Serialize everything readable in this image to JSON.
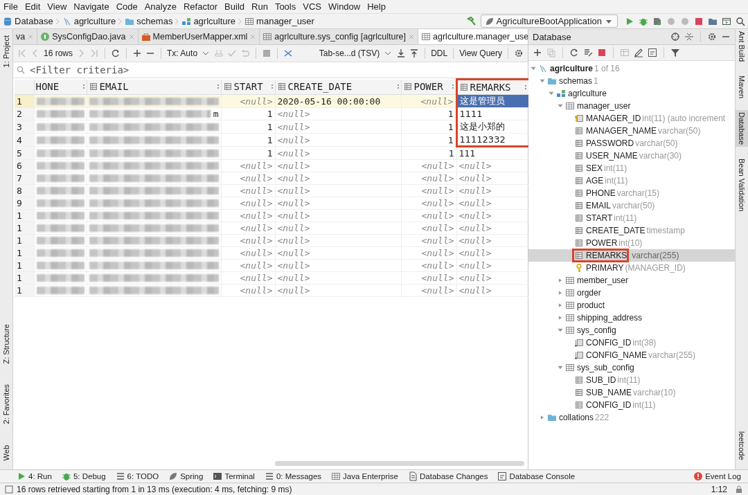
{
  "menu": [
    {
      "label": "File"
    },
    {
      "label": "Edit"
    },
    {
      "label": "View"
    },
    {
      "label": "Navigate"
    },
    {
      "label": "Code"
    },
    {
      "label": "Analyze"
    },
    {
      "label": "Refactor"
    },
    {
      "label": "Build"
    },
    {
      "label": "Run"
    },
    {
      "label": "Tools"
    },
    {
      "label": "VCS"
    },
    {
      "label": "Window"
    },
    {
      "label": "Help"
    }
  ],
  "breadcrumb": [
    {
      "label": "Database",
      "kind": "db"
    },
    {
      "label": "agrlculture",
      "kind": "conn"
    },
    {
      "label": "schemas",
      "kind": "folder"
    },
    {
      "label": "agrlculture",
      "kind": "schema"
    },
    {
      "label": "manager_user",
      "kind": "table"
    }
  ],
  "run_config": {
    "label": "AgricultureBootApplication"
  },
  "left_tool_windows": [
    {
      "label": "1: Project",
      "kind": "top"
    },
    {
      "label": "Z: Structure",
      "kind": "bottom"
    },
    {
      "label": "2: Favorites",
      "kind": "bottom"
    },
    {
      "label": "Web",
      "kind": "bottom"
    }
  ],
  "editor_tabs": [
    {
      "label": "va",
      "kind": "none",
      "selected": false
    },
    {
      "label": "SysConfigDao.java",
      "kind": "java",
      "selected": false
    },
    {
      "label": "MemberUserMapper.xml",
      "kind": "xml",
      "selected": false
    },
    {
      "label": "agrlculture.sys_config [agrlculture]",
      "kind": "table",
      "selected": false
    },
    {
      "label": "agrlculture.manager_use",
      "kind": "table",
      "selected": true
    }
  ],
  "data_toolbar": {
    "rows": "16 rows",
    "transaction": "Tx: Auto",
    "format": "Tab-se...d (TSV)",
    "ddl": "DDL",
    "view_query": "View Query"
  },
  "filter": {
    "placeholder": "<Filter criteria>"
  },
  "table": {
    "columns": [
      {
        "label": "HONE",
        "kind": "text",
        "highlighted": false
      },
      {
        "label": "EMAIL",
        "kind": "text",
        "highlighted": false
      },
      {
        "label": "START",
        "kind": "number",
        "highlighted": false
      },
      {
        "label": "CREATE_DATE",
        "kind": "text",
        "highlighted": false
      },
      {
        "label": "POWER",
        "kind": "number",
        "highlighted": false
      },
      {
        "label": "REMARKS",
        "kind": "text",
        "highlighted": true
      }
    ],
    "rows": [
      {
        "number": "1",
        "current": true,
        "highlighted": true,
        "cells": [
          {
            "kind": "redacted",
            "selected": false
          },
          {
            "kind": "redacted",
            "selected": false
          },
          {
            "kind": "null",
            "text": "<null>",
            "selected": false
          },
          {
            "kind": "value",
            "text": "2020-05-16 00:00:00",
            "selected": false
          },
          {
            "kind": "null",
            "text": "<null>",
            "selected": false
          },
          {
            "kind": "value",
            "text": "这是管理员",
            "selected": true
          }
        ]
      },
      {
        "number": "2",
        "current": false,
        "highlighted": true,
        "cells": [
          {
            "kind": "redacted",
            "selected": false
          },
          {
            "kind": "redacted",
            "text": "m",
            "selected": false
          },
          {
            "kind": "value",
            "text": "1",
            "selected": false
          },
          {
            "kind": "null",
            "text": "<null>",
            "selected": false
          },
          {
            "kind": "value",
            "text": "1",
            "selected": false
          },
          {
            "kind": "value",
            "text": "1111",
            "selected": false
          }
        ]
      },
      {
        "number": "3",
        "current": false,
        "highlighted": true,
        "cells": [
          {
            "kind": "redacted",
            "selected": false
          },
          {
            "kind": "redacted",
            "selected": false
          },
          {
            "kind": "value",
            "text": "1",
            "selected": false
          },
          {
            "kind": "null",
            "text": "<null>",
            "selected": false
          },
          {
            "kind": "value",
            "text": "1",
            "selected": false
          },
          {
            "kind": "value",
            "text": "这是小郑的",
            "selected": false
          }
        ]
      },
      {
        "number": "4",
        "current": false,
        "highlighted": true,
        "cells": [
          {
            "kind": "redacted",
            "selected": false
          },
          {
            "kind": "redacted",
            "selected": false
          },
          {
            "kind": "value",
            "text": "1",
            "selected": false
          },
          {
            "kind": "null",
            "text": "<null>",
            "selected": false
          },
          {
            "kind": "value",
            "text": "1",
            "selected": false
          },
          {
            "kind": "value",
            "text": "11112332",
            "selected": false
          }
        ]
      },
      {
        "number": "5",
        "current": false,
        "highlighted": false,
        "cells": [
          {
            "kind": "redacted",
            "selected": false
          },
          {
            "kind": "redacted",
            "selected": false
          },
          {
            "kind": "value",
            "text": "1",
            "selected": false
          },
          {
            "kind": "null",
            "text": "<null>",
            "selected": false
          },
          {
            "kind": "value",
            "text": "1",
            "selected": false
          },
          {
            "kind": "value",
            "text": "111",
            "selected": false
          }
        ]
      },
      {
        "number": "6",
        "current": false,
        "highlighted": false,
        "cells": [
          {
            "kind": "redacted",
            "selected": false
          },
          {
            "kind": "redacted",
            "selected": false
          },
          {
            "kind": "null",
            "text": "<null>",
            "selected": false
          },
          {
            "kind": "null",
            "text": "<null>",
            "selected": false
          },
          {
            "kind": "null",
            "text": "<null>",
            "selected": false
          },
          {
            "kind": "null",
            "text": "<null>",
            "selected": false
          }
        ]
      },
      {
        "number": "7",
        "current": false,
        "highlighted": false,
        "cells": [
          {
            "kind": "redacted",
            "selected": false
          },
          {
            "kind": "redacted",
            "selected": false
          },
          {
            "kind": "null",
            "text": "<null>",
            "selected": false
          },
          {
            "kind": "null",
            "text": "<null>",
            "selected": false
          },
          {
            "kind": "null",
            "text": "<null>",
            "selected": false
          },
          {
            "kind": "null",
            "text": "<null>",
            "selected": false
          }
        ]
      },
      {
        "number": "8",
        "current": false,
        "highlighted": false,
        "cells": [
          {
            "kind": "redacted",
            "selected": false
          },
          {
            "kind": "redacted",
            "selected": false
          },
          {
            "kind": "null",
            "text": "<null>",
            "selected": false
          },
          {
            "kind": "null",
            "text": "<null>",
            "selected": false
          },
          {
            "kind": "null",
            "text": "<null>",
            "selected": false
          },
          {
            "kind": "null",
            "text": "<null>",
            "selected": false
          }
        ]
      },
      {
        "number": "9",
        "current": false,
        "highlighted": false,
        "cells": [
          {
            "kind": "redacted",
            "selected": false
          },
          {
            "kind": "redacted",
            "selected": false
          },
          {
            "kind": "null",
            "text": "<null>",
            "selected": false
          },
          {
            "kind": "null",
            "text": "<null>",
            "selected": false
          },
          {
            "kind": "null",
            "text": "<null>",
            "selected": false
          },
          {
            "kind": "null",
            "text": "<null>",
            "selected": false
          }
        ]
      },
      {
        "number": "1",
        "current": false,
        "highlighted": false,
        "cells": [
          {
            "kind": "redacted",
            "selected": false
          },
          {
            "kind": "redacted",
            "selected": false
          },
          {
            "kind": "null",
            "text": "<null>",
            "selected": false
          },
          {
            "kind": "null",
            "text": "<null>",
            "selected": false
          },
          {
            "kind": "null",
            "text": "<null>",
            "selected": false
          },
          {
            "kind": "null",
            "text": "<null>",
            "selected": false
          }
        ]
      },
      {
        "number": "1",
        "current": false,
        "highlighted": false,
        "cells": [
          {
            "kind": "redacted",
            "selected": false
          },
          {
            "kind": "redacted",
            "selected": false
          },
          {
            "kind": "null",
            "text": "<null>",
            "selected": false
          },
          {
            "kind": "null",
            "text": "<null>",
            "selected": false
          },
          {
            "kind": "null",
            "text": "<null>",
            "selected": false
          },
          {
            "kind": "null",
            "text": "<null>",
            "selected": false
          }
        ]
      },
      {
        "number": "1",
        "current": false,
        "highlighted": false,
        "cells": [
          {
            "kind": "redacted",
            "selected": false
          },
          {
            "kind": "redacted",
            "selected": false
          },
          {
            "kind": "null",
            "text": "<null>",
            "selected": false
          },
          {
            "kind": "null",
            "text": "<null>",
            "selected": false
          },
          {
            "kind": "null",
            "text": "<null>",
            "selected": false
          },
          {
            "kind": "null",
            "text": "<null>",
            "selected": false
          }
        ]
      },
      {
        "number": "1",
        "current": false,
        "highlighted": false,
        "cells": [
          {
            "kind": "redacted",
            "selected": false
          },
          {
            "kind": "redacted",
            "selected": false
          },
          {
            "kind": "null",
            "text": "<null>",
            "selected": false
          },
          {
            "kind": "null",
            "text": "<null>",
            "selected": false
          },
          {
            "kind": "null",
            "text": "<null>",
            "selected": false
          },
          {
            "kind": "null",
            "text": "<null>",
            "selected": false
          }
        ]
      },
      {
        "number": "1",
        "current": false,
        "highlighted": false,
        "cells": [
          {
            "kind": "redacted",
            "selected": false
          },
          {
            "kind": "redacted",
            "selected": false
          },
          {
            "kind": "null",
            "text": "<null>",
            "selected": false
          },
          {
            "kind": "null",
            "text": "<null>",
            "selected": false
          },
          {
            "kind": "null",
            "text": "<null>",
            "selected": false
          },
          {
            "kind": "null",
            "text": "<null>",
            "selected": false
          }
        ]
      },
      {
        "number": "1",
        "current": false,
        "highlighted": false,
        "cells": [
          {
            "kind": "redacted",
            "selected": false
          },
          {
            "kind": "redacted",
            "selected": false
          },
          {
            "kind": "null",
            "text": "<null>",
            "selected": false
          },
          {
            "kind": "null",
            "text": "<null>",
            "selected": false
          },
          {
            "kind": "null",
            "text": "<null>",
            "selected": false
          },
          {
            "kind": "null",
            "text": "<null>",
            "selected": false
          }
        ]
      },
      {
        "number": "1",
        "current": false,
        "highlighted": false,
        "cells": [
          {
            "kind": "redacted",
            "selected": false
          },
          {
            "kind": "redacted",
            "selected": false
          },
          {
            "kind": "null",
            "text": "<null>",
            "selected": false
          },
          {
            "kind": "null",
            "text": "<null>",
            "selected": false
          },
          {
            "kind": "null",
            "text": "<null>",
            "selected": false
          },
          {
            "kind": "null",
            "text": "<null>",
            "selected": false
          }
        ]
      }
    ]
  },
  "database_panel": {
    "title": "Database",
    "tree": [
      {
        "label": "agrlculture",
        "kind": "conn",
        "count": "1 of 16",
        "expanded": true,
        "selected": false,
        "children": [
          {
            "label": "schemas",
            "kind": "folder",
            "count": "1",
            "expanded": true,
            "selected": false,
            "children": [
              {
                "label": "agrlculture",
                "kind": "schema",
                "expanded": true,
                "selected": false,
                "children": [
                  {
                    "label": "manager_user",
                    "kind": "table",
                    "expanded": true,
                    "selected": false,
                    "children": [
                      {
                        "label": "MANAGER_ID",
                        "detail": "int(11) (auto increment",
                        "kind": "pk-column",
                        "selected": false,
                        "highlighted": false
                      },
                      {
                        "label": "MANAGER_NAME",
                        "detail": "varchar(50)",
                        "kind": "column",
                        "selected": false,
                        "highlighted": false
                      },
                      {
                        "label": "PASSWORD",
                        "detail": "varchar(50)",
                        "kind": "column",
                        "selected": false,
                        "highlighted": false
                      },
                      {
                        "label": "USER_NAME",
                        "detail": "varchar(30)",
                        "kind": "column",
                        "selected": false,
                        "highlighted": false
                      },
                      {
                        "label": "SEX",
                        "detail": "int(11)",
                        "kind": "column",
                        "selected": false,
                        "highlighted": false
                      },
                      {
                        "label": "AGE",
                        "detail": "int(11)",
                        "kind": "column",
                        "selected": false,
                        "highlighted": false
                      },
                      {
                        "label": "PHONE",
                        "detail": "varchar(15)",
                        "kind": "column",
                        "selected": false,
                        "highlighted": false
                      },
                      {
                        "label": "EMAIL",
                        "detail": "varchar(50)",
                        "kind": "column",
                        "selected": false,
                        "highlighted": false
                      },
                      {
                        "label": "START",
                        "detail": "int(11)",
                        "kind": "column",
                        "selected": false,
                        "highlighted": false
                      },
                      {
                        "label": "CREATE_DATE",
                        "detail": "timestamp",
                        "kind": "column",
                        "selected": false,
                        "highlighted": false
                      },
                      {
                        "label": "POWER",
                        "detail": "int(10)",
                        "kind": "column",
                        "selected": false,
                        "highlighted": false
                      },
                      {
                        "label": "REMARKS",
                        "detail": "varchar(255)",
                        "kind": "column",
                        "selected": true,
                        "highlighted": true
                      },
                      {
                        "label": "PRIMARY",
                        "detail": "(MANAGER_ID)",
                        "kind": "key",
                        "selected": false,
                        "highlighted": false
                      }
                    ]
                  },
                  {
                    "label": "member_user",
                    "kind": "table",
                    "expanded": false,
                    "selected": false
                  },
                  {
                    "label": "orgder",
                    "kind": "table",
                    "expanded": false,
                    "selected": false
                  },
                  {
                    "label": "product",
                    "kind": "table",
                    "expanded": false,
                    "selected": false
                  },
                  {
                    "label": "shipping_address",
                    "kind": "table",
                    "expanded": false,
                    "selected": false
                  },
                  {
                    "label": "sys_config",
                    "kind": "table",
                    "expanded": true,
                    "selected": false,
                    "children": [
                      {
                        "label": "CONFIG_ID",
                        "detail": "int(38)",
                        "kind": "fk-column",
                        "selected": false
                      },
                      {
                        "label": "CONFIG_NAME",
                        "detail": "varchar(255)",
                        "kind": "fk-column",
                        "selected": false
                      }
                    ]
                  },
                  {
                    "label": "sys_sub_config",
                    "kind": "table",
                    "expanded": true,
                    "selected": false,
                    "children": [
                      {
                        "label": "SUB_ID",
                        "detail": "int(11)",
                        "kind": "column",
                        "selected": false
                      },
                      {
                        "label": "SUB_NAME",
                        "detail": "varchar(10)",
                        "kind": "column",
                        "selected": false
                      },
                      {
                        "label": "CONFIG_ID",
                        "detail": "int(11)",
                        "kind": "column",
                        "selected": false
                      }
                    ]
                  }
                ]
              }
            ]
          },
          {
            "label": "collations",
            "kind": "folder",
            "count": "222",
            "expanded": false,
            "selected": false
          }
        ]
      }
    ]
  },
  "right_tool_windows": [
    {
      "label": "Ant Build",
      "kind": "top",
      "selected": false
    },
    {
      "label": "Maven",
      "kind": "top",
      "selected": false
    },
    {
      "label": "Database",
      "kind": "top",
      "selected": true
    },
    {
      "label": "Bean Validation",
      "kind": "top",
      "selected": false
    },
    {
      "label": "leetcode",
      "kind": "bottom",
      "selected": false
    }
  ],
  "bottom_tools": [
    {
      "label": "4: Run",
      "kind": "run"
    },
    {
      "label": "5: Debug",
      "kind": "debug"
    },
    {
      "label": "6: TODO",
      "kind": "list"
    },
    {
      "label": "Spring",
      "kind": "leaf"
    },
    {
      "label": "Terminal",
      "kind": "terminal"
    },
    {
      "label": "0: Messages",
      "kind": "list"
    },
    {
      "label": "Java Enterprise",
      "kind": "table"
    },
    {
      "label": "Database Changes",
      "kind": "doc"
    },
    {
      "label": "Database Console",
      "kind": "console"
    }
  ],
  "event_log": {
    "label": "Event Log"
  },
  "status_bar": {
    "message": "16 rows retrieved starting from 1 in 13 ms (execution: 4 ms, fetching: 9 ms)",
    "position": "1:12"
  }
}
